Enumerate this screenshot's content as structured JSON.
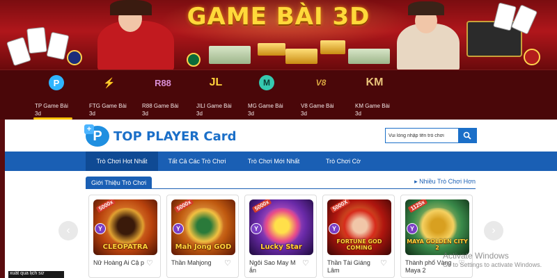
{
  "banner": {
    "title": "GAME BÀI 3D"
  },
  "providers": [
    {
      "label": "TP Game Bài",
      "sub": "3d",
      "logo": "P",
      "color": "#2fb5ff",
      "active": true
    },
    {
      "label": "FTG Game Bài",
      "sub": "3d",
      "logo": "⚡",
      "color": "#8a4dd8",
      "active": false
    },
    {
      "label": "R88 Game Bài",
      "sub": "3d",
      "logo": "R88",
      "color": "#d98fd6",
      "active": false
    },
    {
      "label": "JILI Game Bài",
      "sub": "3d",
      "logo": "JL",
      "color": "#ffd23a",
      "active": false
    },
    {
      "label": "MG Game Bài",
      "sub": "3d",
      "logo": "M",
      "color": "#36c9b0",
      "active": false
    },
    {
      "label": "V8 Game Bài",
      "sub": "3d",
      "logo": "V8",
      "color": "#d9a640",
      "active": false
    },
    {
      "label": "KM Game Bài",
      "sub": "3d",
      "logo": "KM",
      "color": "#e9c37a",
      "active": false
    }
  ],
  "site": {
    "logo_text": "TOP PLAYER Card"
  },
  "search": {
    "placeholder": "Vui lòng nhập tên trò chơi"
  },
  "tabs": [
    {
      "label": "Trò Chơi Hot Nhất",
      "active": true
    },
    {
      "label": "Tất Cả Các Trò Chơi",
      "active": false
    },
    {
      "label": "Trò Chơi Mới Nhất",
      "active": false
    },
    {
      "label": "Trò Chơi Cờ",
      "active": false
    }
  ],
  "section": {
    "title": "Giới Thiệu Trò Chơi",
    "more": "▸ Nhiều Trò Chơi Hơn"
  },
  "games": [
    {
      "name": "Nữ Hoàng Ai Cậ p",
      "art": "CLEOPATRA",
      "badge": "5000x",
      "provider": "TP",
      "bg": "#b8420d"
    },
    {
      "name": "Thần Mahjong",
      "art": "Mah Jong GOD",
      "badge": "5000x",
      "provider": "TP",
      "bg": "#7a1f08"
    },
    {
      "name": "Ngôi Sao May M ắn",
      "art": "Lucky Star",
      "badge": "5000x",
      "provider": "TP",
      "bg": "#5a2a9a"
    },
    {
      "name": "Thần Tài Giáng Lâm",
      "art": "FORTUNE GOD COMING",
      "badge": "5000X",
      "provider": "TP",
      "bg": "#9a1410"
    },
    {
      "name": "Thành phố Vàng Maya 2",
      "art": "MAYA GOLDEN CITY 2",
      "badge": "1125x",
      "provider": "TP",
      "bg": "#2a6a3a"
    }
  ],
  "watermark": {
    "line1": "Activate Windows",
    "line2": "Go to Settings to activate Windows."
  },
  "history": {
    "label": "xuất qua lịch sử"
  },
  "colors": {
    "primary": "#1a5fb4",
    "banner": "#b0161b",
    "provider_bar": "#4a0709"
  }
}
